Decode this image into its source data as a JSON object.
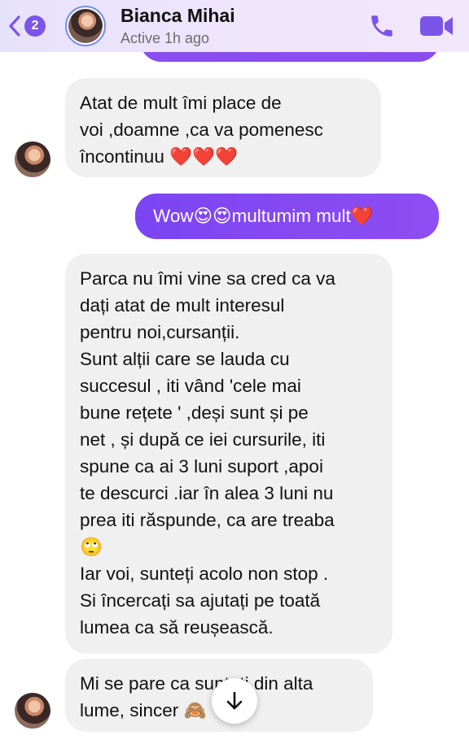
{
  "header": {
    "back_badge": "2",
    "contact_name": "Bianca Mihai",
    "status": "Active 1h ago"
  },
  "messages": [
    {
      "from": "contact",
      "text": "Atat de mult îmi place de\nvoi ,doamne ,ca va pomenesc\nîncontinuu ❤️❤️❤️"
    },
    {
      "from": "me",
      "text": "Wow😍😍multumim mult❤️"
    },
    {
      "from": "contact",
      "text": "Parca nu îmi vine sa cred ca va\ndați atat de mult interesul\npentru noi,cursanții.\nSunt alții care se lauda cu\nsuccesul , iti vând 'cele mai\nbune rețete ' ,deși sunt și pe\nnet , și după ce iei cursurile, iti\nspune ca ai 3 luni suport ,apoi\nte descurci .iar în alea 3 luni nu\nprea iti răspunde, ca are treaba\n🙄\nIar voi, sunteți acolo non stop .\nSi încercați sa ajutați pe toată\nlumea ca să reușească."
    },
    {
      "from": "contact",
      "text": "Mi se pare ca sunteți din alta\nlume, sincer 🙈"
    }
  ],
  "icons": {
    "back": "chevron-left-icon",
    "call": "phone-icon",
    "video": "video-camera-icon",
    "scroll": "arrow-down-icon"
  },
  "colors": {
    "accent": "#7b54e8",
    "sent_bubble": "#8a4df0",
    "received_bubble": "#f0f0f0"
  }
}
